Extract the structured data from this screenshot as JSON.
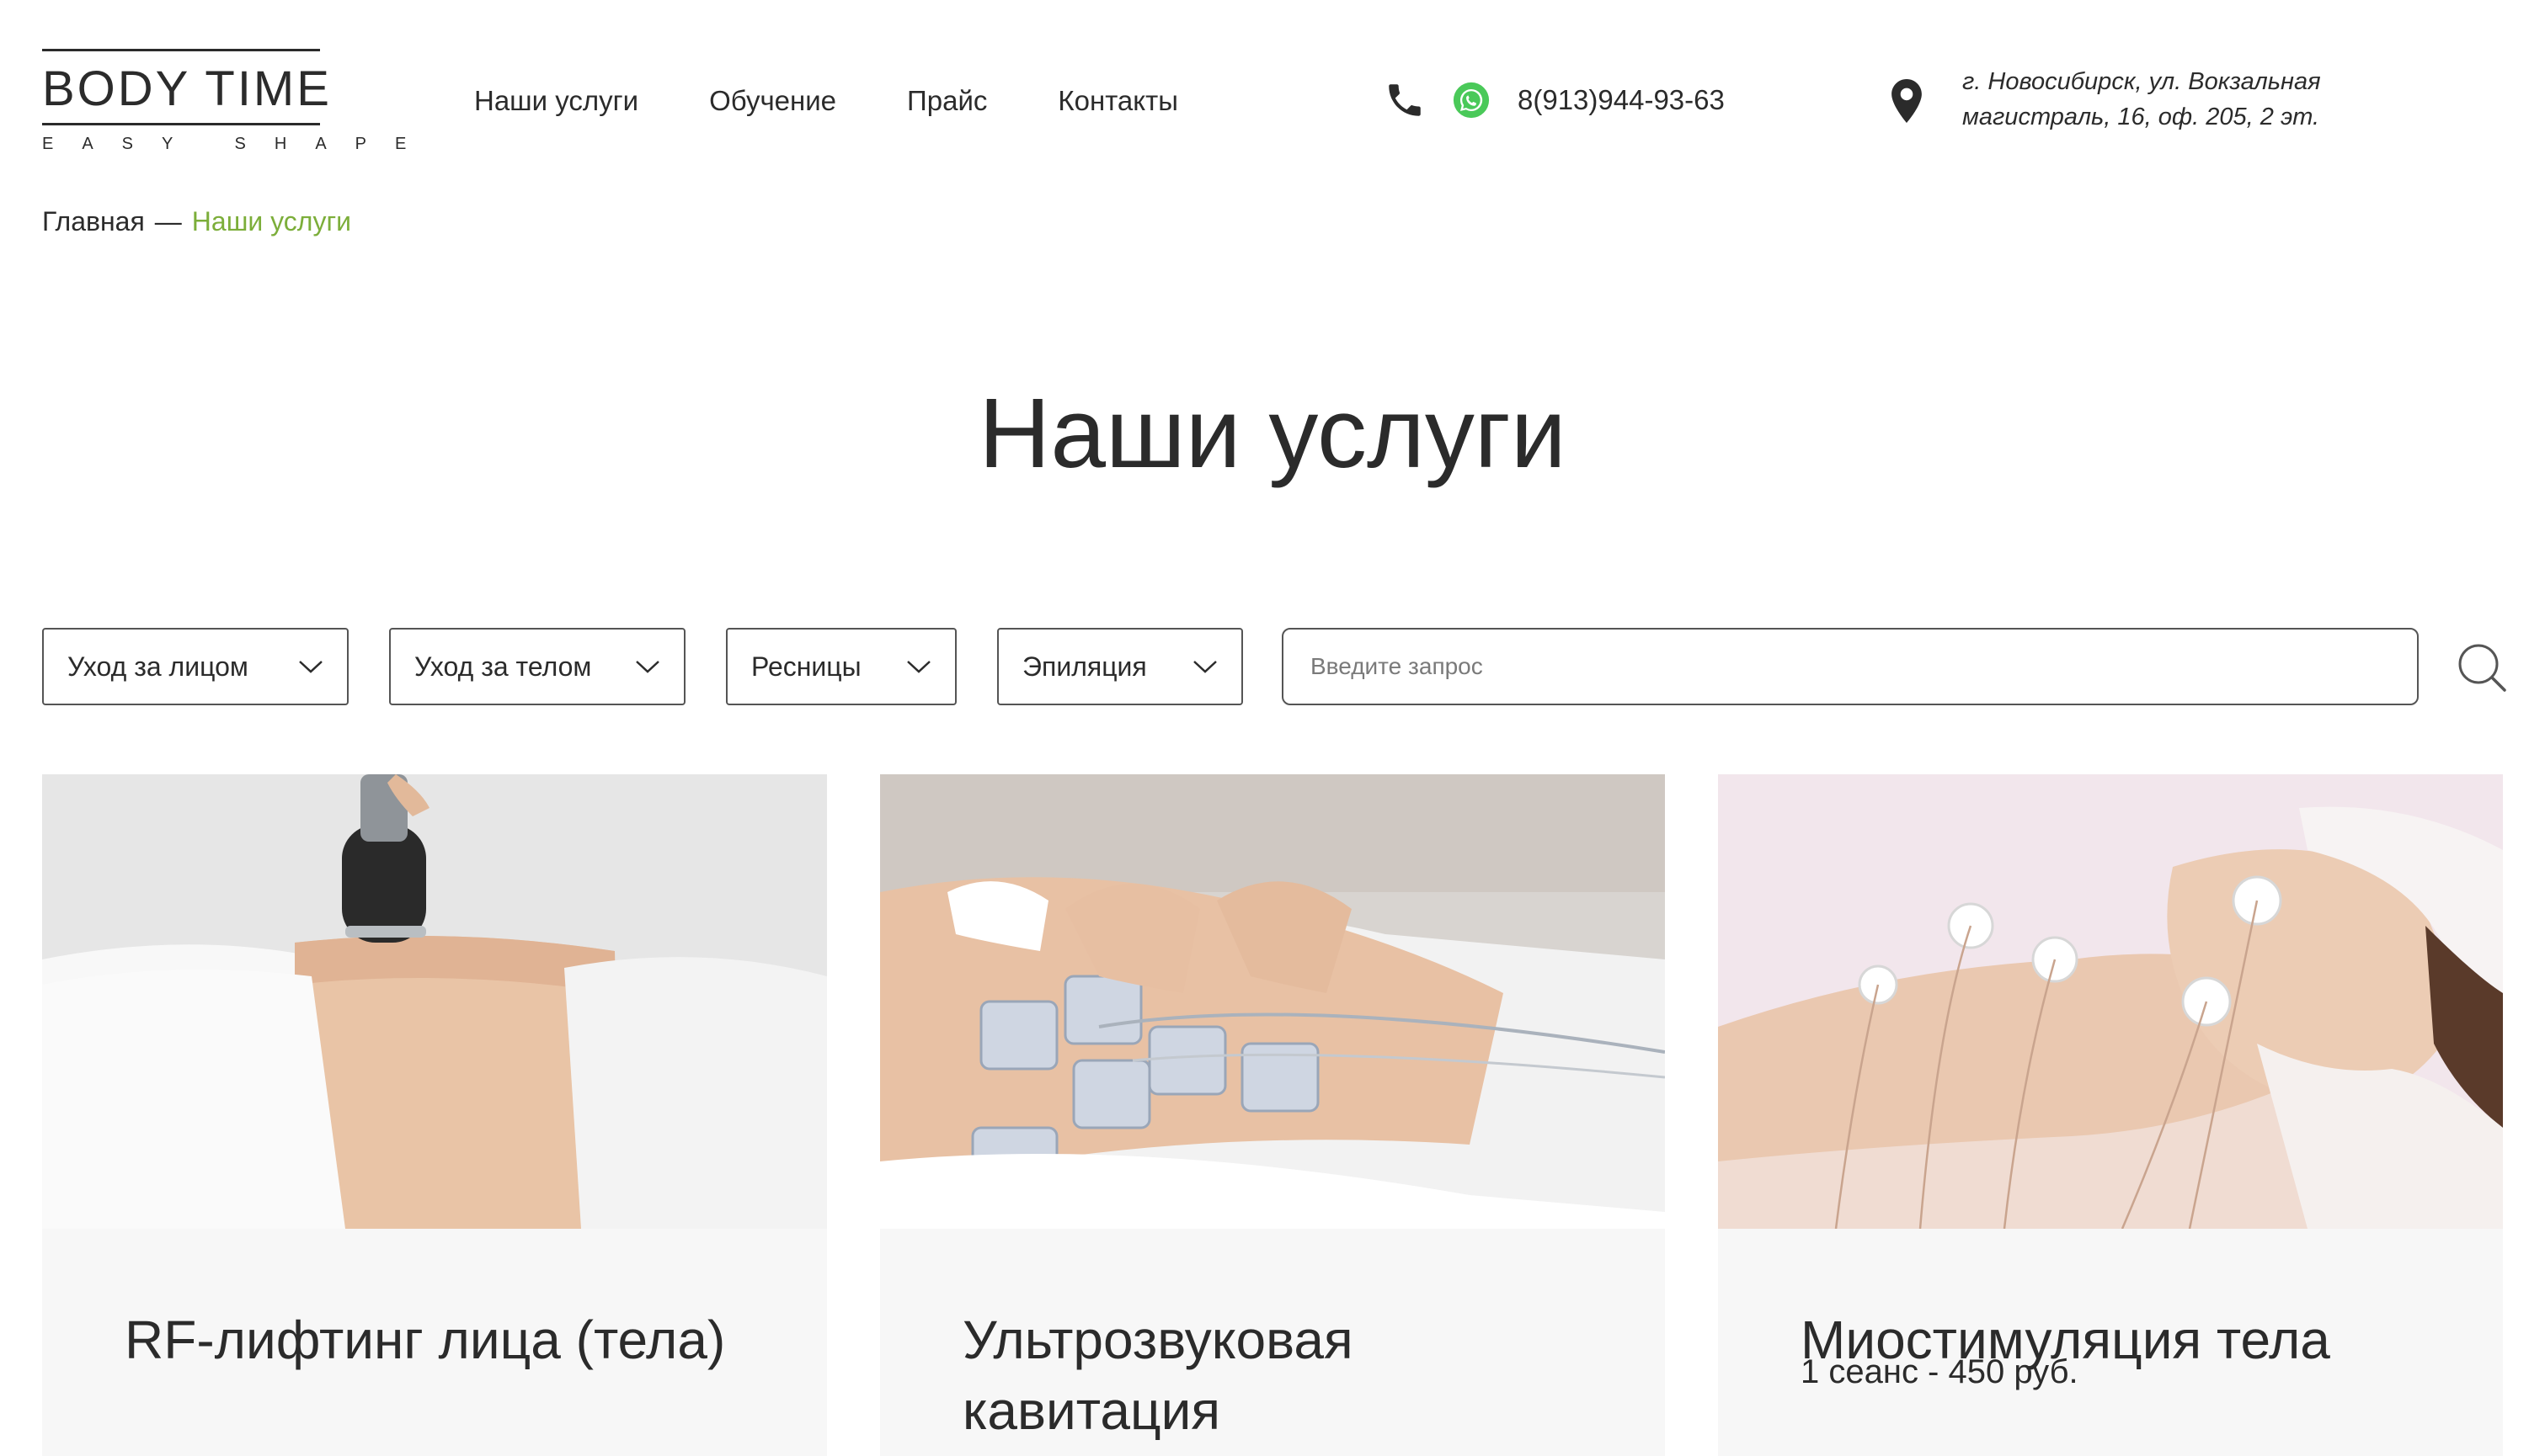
{
  "header": {
    "logo": {
      "brand": "BODY TIME",
      "tagline": "EASY SHAPE"
    },
    "nav": [
      "Наши услуги",
      "Обучение",
      "Прайс",
      "Контакты"
    ],
    "phone": "8(913)944-93-63",
    "address": "г. Новосибирск, ул. Вокзальная магистраль, 16, оф. 205, 2 эт.",
    "icons": {
      "phone": "phone-icon",
      "messenger": "whatsapp-icon",
      "location": "map-pin-icon"
    }
  },
  "breadcrumb": {
    "home": "Главная",
    "separator": "—",
    "current": "Наши услуги"
  },
  "page": {
    "title": "Наши услуги"
  },
  "filters": {
    "dropdowns": [
      "Уход за лицом",
      "Уход за телом",
      "Ресницы",
      "Эпиляция"
    ],
    "search_placeholder": "Введите запрос",
    "search_icon": "search-icon"
  },
  "cards": [
    {
      "title": "RF-лифтинг лица (тела)",
      "price": ""
    },
    {
      "title": "Ультрозвуковая кавитация",
      "price": ""
    },
    {
      "title": "Миостимуляция тела",
      "price": "1 сеанс - 450 руб."
    }
  ],
  "colors": {
    "text": "#2b2b2b",
    "accent_green": "#7cae3a",
    "whatsapp_green": "#4ac959",
    "card_background": "#f7f7f7"
  }
}
